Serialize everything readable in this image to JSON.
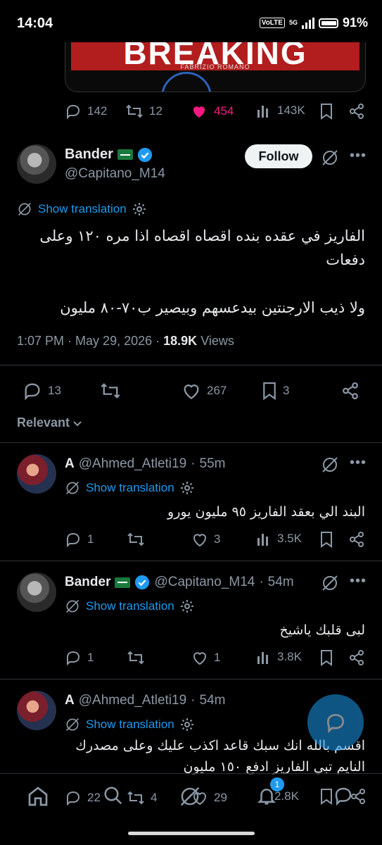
{
  "status_bar": {
    "time": "14:04",
    "volte": "VoLTE",
    "network": "5G",
    "battery": "91%"
  },
  "media_card": {
    "headline": "BREAKING",
    "credit": "FABRIZIO ROMANO"
  },
  "prev_tweet_actions": {
    "replies": "142",
    "reposts": "12",
    "likes": "454",
    "views": "143K"
  },
  "main_tweet": {
    "name": "Bander",
    "handle": "@Capitano_M14",
    "follow_label": "Follow",
    "translate_label": "Show translation",
    "text_line1": "الفاريز في عقده بنده اقصاه اقصاه اذا مره ١٢٠ وعلى",
    "text_line2": "دفعات",
    "text_line3": "ولا ذيب الارجنتين بيدعسهم وبيصير ب٧٠-٨٠ مليون",
    "time": "1:07 PM",
    "date": "May 29, 2026",
    "views_count": "18.9K",
    "views_label": "Views",
    "replies": "13",
    "likes": "267",
    "bookmarks": "3"
  },
  "sort_label": "Relevant",
  "replies": [
    {
      "name": "A",
      "handle": "@Ahmed_Atleti19",
      "time": "55m",
      "translate_label": "Show translation",
      "text_line1": "البند الي بعقد الفاريز ٩٥ مليون يورو",
      "replies": "1",
      "likes": "3",
      "views": "3.5K"
    },
    {
      "name": "Bander",
      "handle": "@Capitano_M14",
      "time": "54m",
      "translate_label": "Show translation",
      "text_line1": "لبى قلبك ياشيخ",
      "replies": "1",
      "likes": "1",
      "views": "3.8K"
    },
    {
      "name": "A",
      "handle": "@Ahmed_Atleti19",
      "time": "54m",
      "translate_label": "Show translation",
      "text_line1": "اقسم بالله انك سبك قاعد اكذب عليك وعلى مصدرك",
      "text_line2": "النايم تبي الفاريز ادفع ١٥٠ مليون",
      "replies": "22",
      "reposts": "4",
      "likes": "29",
      "views": "2.8K"
    }
  ],
  "nav": {
    "notification_badge": "1"
  },
  "colors": {
    "accent": "#1d9bf0",
    "like": "#f91880",
    "muted": "#8b98a5",
    "background": "#000000"
  }
}
